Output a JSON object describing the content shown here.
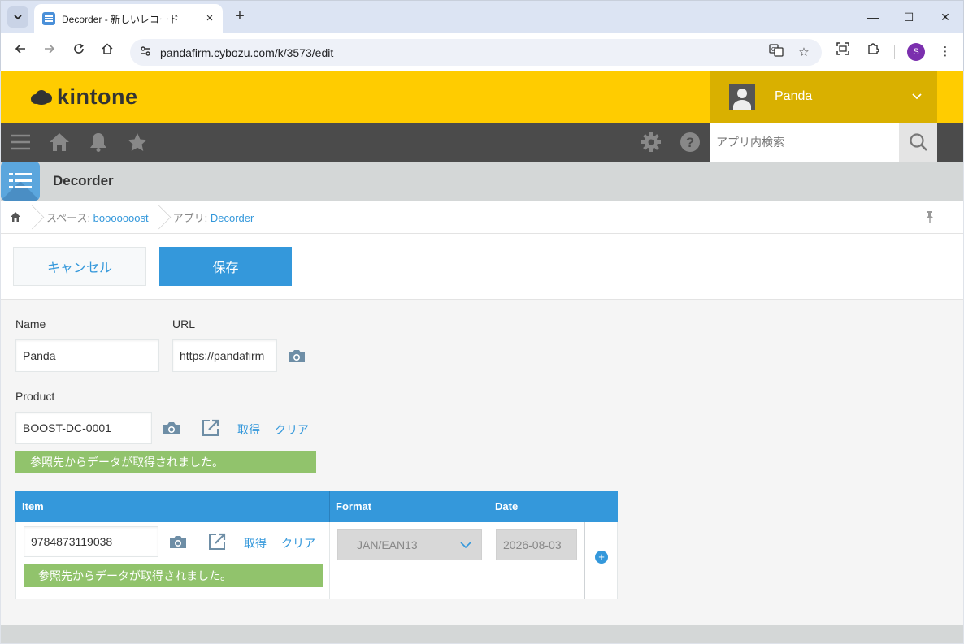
{
  "browser": {
    "tab_title": "Decorder - 新しいレコード",
    "url": "pandafirm.cybozu.com/k/3573/edit",
    "profile_initial": "S"
  },
  "header": {
    "logo_text": "kintone",
    "user_name": "Panda"
  },
  "nav": {
    "search_placeholder": "アプリ内検索",
    "icons": [
      "menu-icon",
      "home-icon",
      "bell-icon",
      "star-icon",
      "gear-icon",
      "help-icon",
      "search-icon"
    ]
  },
  "app": {
    "name": "Decorder"
  },
  "breadcrumb": {
    "space_prefix": "スペース: ",
    "space_name": "booooooost",
    "app_prefix": "アプリ: ",
    "app_name": "Decorder"
  },
  "actions": {
    "cancel_label": "キャンセル",
    "save_label": "保存"
  },
  "form": {
    "name_label": "Name",
    "name_value": "Panda",
    "url_label": "URL",
    "url_value": "https://pandafirm",
    "product_label": "Product",
    "product_value": "BOOST-DC-0001",
    "fetch_label": "取得",
    "clear_label": "クリア",
    "product_message": "参照先からデータが取得されました。"
  },
  "table": {
    "headers": [
      "Item",
      "Format",
      "Date"
    ],
    "rows": [
      {
        "item": "9784873119038",
        "fetch_label": "取得",
        "clear_label": "クリア",
        "message": "参照先からデータが取得されました。",
        "format": "JAN/EAN13",
        "date": "2026-08-03"
      }
    ]
  },
  "colors": {
    "header_yellow": "#ffcc00",
    "user_bg": "#d9b000",
    "nav_bg": "#4b4b4b",
    "accent_blue": "#3498db",
    "success_green": "#91c36c"
  }
}
